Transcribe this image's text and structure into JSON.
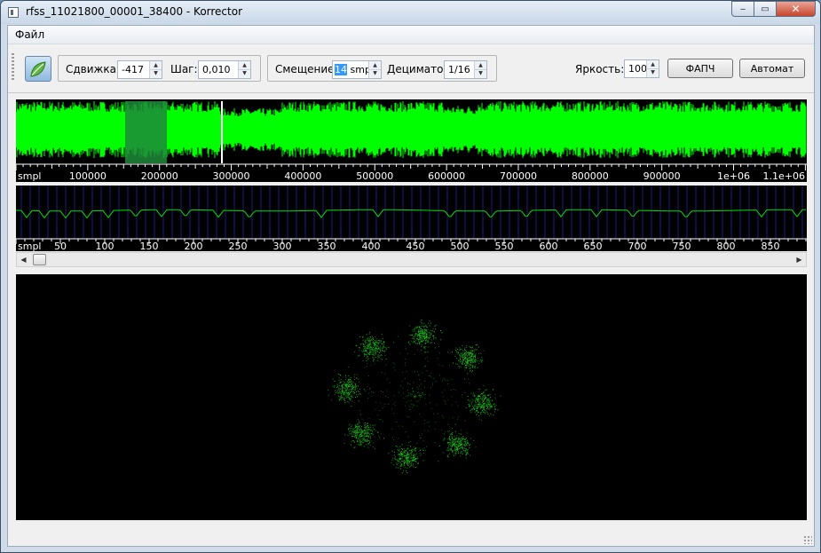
{
  "window": {
    "title": "rfss_11021800_00001_38400 - Korrector",
    "minimize_glyph": "‒",
    "maximize_glyph": "▭",
    "close_glyph": "✕"
  },
  "menu": {
    "file": "Файл"
  },
  "toolbar": {
    "leaf_icon": "leaf-icon",
    "shift_label": "Сдвижка:",
    "shift_value": "-417",
    "step_label": "Шаг:",
    "step_value": "0,010",
    "offset_label": "Смещение:",
    "offset_value": "14",
    "offset_unit": "smpl",
    "decimator_label": "Дециматор:",
    "decimator_value": "1/16",
    "brightness_label": "Яркость:",
    "brightness_value": "100",
    "pll_button": "ФАПЧ",
    "auto_button": "Автомат"
  },
  "overview": {
    "axis_ticks": [
      "smpl",
      "100000",
      "200000",
      "300000",
      "400000",
      "500000",
      "600000",
      "700000",
      "800000",
      "900000",
      "1e+06",
      "1.1e+06"
    ],
    "colors": {
      "signal": "#00ff00",
      "selection": "#1f8a3a"
    }
  },
  "detail": {
    "axis_ticks": [
      "smpl",
      "50",
      "100",
      "150",
      "200",
      "250",
      "300",
      "350",
      "400",
      "450",
      "500",
      "550",
      "600",
      "650",
      "700",
      "750",
      "800",
      "850"
    ],
    "colors": {
      "trace": "#00e000",
      "grid": "#1c1c8a"
    }
  },
  "constellation": {
    "colors": {
      "points": "#1ccc1c"
    }
  },
  "scrollbar": {
    "left_arrow": "◀",
    "right_arrow": "▶"
  }
}
